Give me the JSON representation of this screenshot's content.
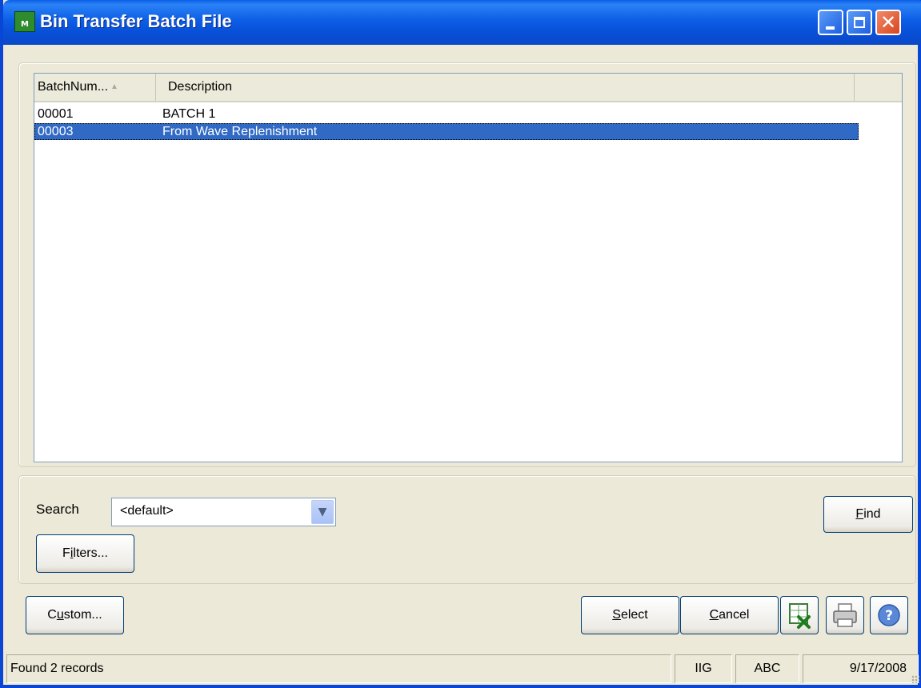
{
  "window": {
    "title": "Bin Transfer Batch File",
    "icon_label": "M"
  },
  "grid": {
    "columns": [
      "BatchNum...",
      "Description",
      ""
    ],
    "sort_indicator": "▲",
    "rows": [
      {
        "batch": "00001",
        "description": "BATCH 1",
        "selected": false
      },
      {
        "batch": "00003",
        "description": "From Wave Replenishment",
        "selected": true
      }
    ]
  },
  "search": {
    "label": "Search",
    "value": "<default>"
  },
  "buttons": {
    "find": {
      "mnemonic": "F",
      "rest": "ind"
    },
    "filters": {
      "pre": "F",
      "mnemonic": "i",
      "rest": "lters..."
    },
    "custom": {
      "pre": "C",
      "mnemonic": "u",
      "rest": "stom..."
    },
    "select": {
      "mnemonic": "S",
      "rest": "elect"
    },
    "cancel": {
      "mnemonic": "C",
      "rest": "ancel"
    }
  },
  "icons": {
    "excel": "excel-export-icon",
    "print": "printer-icon",
    "help": "help-icon"
  },
  "status": {
    "message": "Found 2 records",
    "company": "IIG",
    "user": "ABC",
    "date": "9/17/2008"
  },
  "colors": {
    "titlebar": "#0a5fe8",
    "selection": "#316ac5",
    "face": "#ece9d8"
  }
}
